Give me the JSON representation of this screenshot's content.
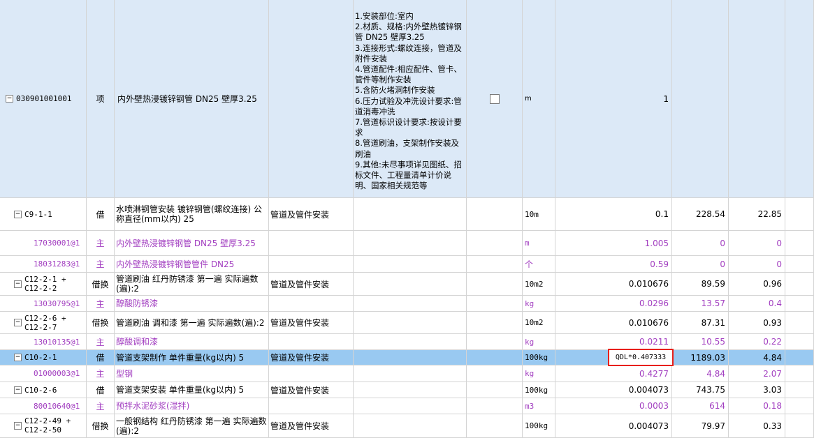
{
  "main_item": {
    "code": "030901001001",
    "type": "项",
    "name": "内外壁热浸镀锌钢管 DN25 壁厚3.25",
    "description": "1.安装部位:室内\n2.材质、规格:内外壁热镀锌钢管 DN25 壁厚3.25\n3.连接形式:螺纹连接，管道及附件安装\n4.管道配件:相应配件、管卡、管件等制作安装\n5.含防火堵洞制作安装\n6.压力试验及冲洗设计要求:管道消毒冲洗\n7.管道标识设计要求:按设计要求\n8.管道刷油，支架制作安装及刷油\n9.其他:未尽事项详见图纸、招标文件、工程量清单计价说明、国家相关规范等",
    "unit": "m",
    "quantity": "1"
  },
  "rows": [
    {
      "code": "C9-1-1",
      "type": "借",
      "name": "水喷淋钢管安装 镀锌钢管(螺纹连接) 公称直径(mm以内) 25",
      "major": "管道及管件安装",
      "unit": "10m",
      "qty": "0.1",
      "price": "228.54",
      "total": "22.85",
      "kind": "main"
    },
    {
      "code": "17030001@1",
      "type": "主",
      "name": "内外壁热浸镀锌钢管 DN25 壁厚3.25",
      "major": "",
      "unit": "m",
      "qty": "1.005",
      "price": "0",
      "total": "0",
      "kind": "sub"
    },
    {
      "code": "18031283@1",
      "type": "主",
      "name": "内外壁热浸镀锌钢管管件 DN25",
      "major": "",
      "unit": "个",
      "qty": "0.59",
      "price": "0",
      "total": "0",
      "kind": "sub"
    },
    {
      "code": "C12-2-1 + C12-2-2",
      "type": "借换",
      "name": "管道刷油 红丹防锈漆 第一遍  实际遍数(遍):2",
      "major": "管道及管件安装",
      "unit": "10m2",
      "qty": "0.010676",
      "price": "89.59",
      "total": "0.96",
      "kind": "main"
    },
    {
      "code": "13030795@1",
      "type": "主",
      "name": "醇酸防锈漆",
      "major": "",
      "unit": "kg",
      "qty": "0.0296",
      "price": "13.57",
      "total": "0.4",
      "kind": "sub"
    },
    {
      "code": "C12-2-6 + C12-2-7",
      "type": "借换",
      "name": "管道刷油 调和漆 第一遍  实际遍数(遍):2",
      "major": "管道及管件安装",
      "unit": "10m2",
      "qty": "0.010676",
      "price": "87.31",
      "total": "0.93",
      "kind": "main"
    },
    {
      "code": "13010135@1",
      "type": "主",
      "name": "醇酸调和漆",
      "major": "",
      "unit": "kg",
      "qty": "0.0211",
      "price": "10.55",
      "total": "0.22",
      "kind": "sub"
    },
    {
      "code": "C10-2-1",
      "type": "借",
      "name": "管道支架制作 单件重量(kg以内) 5",
      "major": "管道及管件安装",
      "unit": "100kg",
      "qty": "QDL*0.407333",
      "price": "1189.03",
      "total": "4.84",
      "kind": "main"
    },
    {
      "code": "01000003@1",
      "type": "主",
      "name": "型钢",
      "major": "",
      "unit": "kg",
      "qty": "0.4277",
      "price": "4.84",
      "total": "2.07",
      "kind": "sub"
    },
    {
      "code": "C10-2-6",
      "type": "借",
      "name": "管道支架安装 单件重量(kg以内) 5",
      "major": "管道及管件安装",
      "unit": "100kg",
      "qty": "0.004073",
      "price": "743.75",
      "total": "3.03",
      "kind": "main"
    },
    {
      "code": "80010640@1",
      "type": "主",
      "name": "预拌水泥砂浆(湿拌)",
      "major": "",
      "unit": "m3",
      "qty": "0.0003",
      "price": "614",
      "total": "0.18",
      "kind": "sub"
    },
    {
      "code": "C12-2-49 + C12-2-50",
      "type": "借换",
      "name": "一般钢结构 红丹防锈漆 第一遍  实际遍数(遍):2",
      "major": "管道及管件安装",
      "unit": "100kg",
      "qty": "0.004073",
      "price": "79.97",
      "total": "0.33",
      "kind": "main"
    }
  ],
  "colors": {
    "selected_row": "#99c9f1",
    "header_item_row": "#dce9f7",
    "sub_text": "#a23ec0",
    "formula_border": "#e8201a"
  },
  "icons": {
    "collapse": "minus-box-icon",
    "checkbox": "checkbox-icon"
  }
}
